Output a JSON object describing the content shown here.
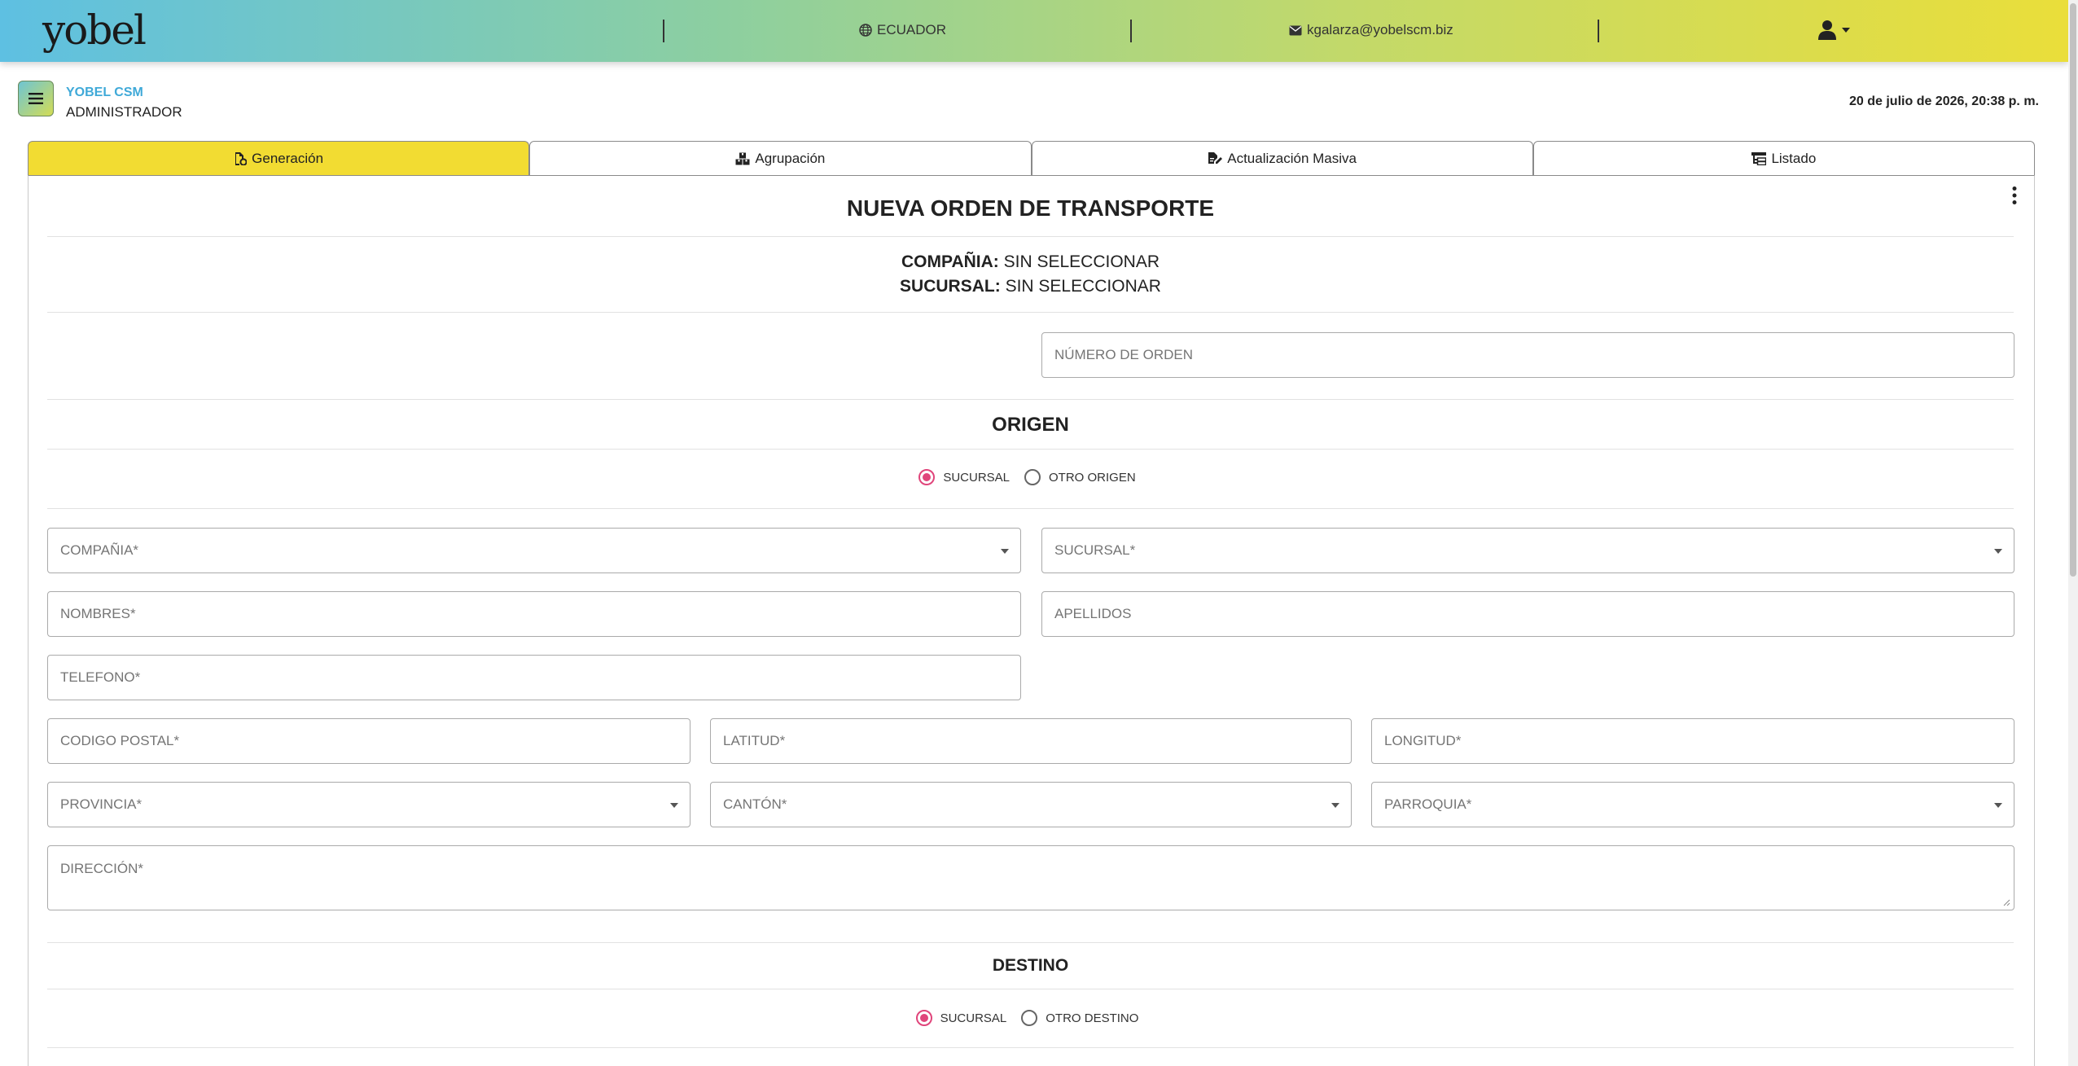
{
  "header": {
    "logo": "yobel",
    "country": "ECUADOR",
    "email": "kgalarza@yobelscm.biz"
  },
  "user": {
    "company": "YOBEL CSM",
    "role": "ADMINISTRADOR",
    "datetime": "20 de julio de 2026, 20:38 p. m."
  },
  "tabs": [
    {
      "label": "Generación",
      "icon": "file-gear-icon",
      "active": true
    },
    {
      "label": "Agrupación",
      "icon": "boxes-icon",
      "active": false
    },
    {
      "label": "Actualización Masiva",
      "icon": "file-edit-icon",
      "active": false
    },
    {
      "label": "Listado",
      "icon": "list-tree-icon",
      "active": false
    }
  ],
  "form": {
    "title": "NUEVA ORDEN DE TRANSPORTE",
    "company_label": "COMPAÑIA:",
    "company_value": "SIN SELECCIONAR",
    "branch_label": "SUCURSAL:",
    "branch_value": "SIN SELECCIONAR",
    "order_number_placeholder": "NÚMERO DE ORDEN",
    "origin": {
      "title": "ORIGEN",
      "option_branch": "SUCURSAL",
      "option_other": "OTRO ORIGEN",
      "selected": "SUCURSAL",
      "company_placeholder": "COMPAÑIA*",
      "branch_placeholder": "SUCURSAL*",
      "names_placeholder": "NOMBRES*",
      "surnames_placeholder": "APELLIDOS",
      "phone_placeholder": "TELEFONO*",
      "postal_placeholder": "CODIGO POSTAL*",
      "latitude_placeholder": "LATITUD*",
      "longitude_placeholder": "LONGITUD*",
      "province_placeholder": "PROVINCIA*",
      "canton_placeholder": "CANTÓN*",
      "parish_placeholder": "PARROQUIA*",
      "address_placeholder": "DIRECCIÓN*"
    },
    "destination": {
      "title": "DESTINO",
      "option_branch": "SUCURSAL",
      "option_other": "OTRO DESTINO",
      "selected": "SUCURSAL"
    }
  },
  "colors": {
    "accent_yellow": "#f2dc32",
    "radio_pink": "#e0457b",
    "company_blue": "#3fa9d8"
  }
}
